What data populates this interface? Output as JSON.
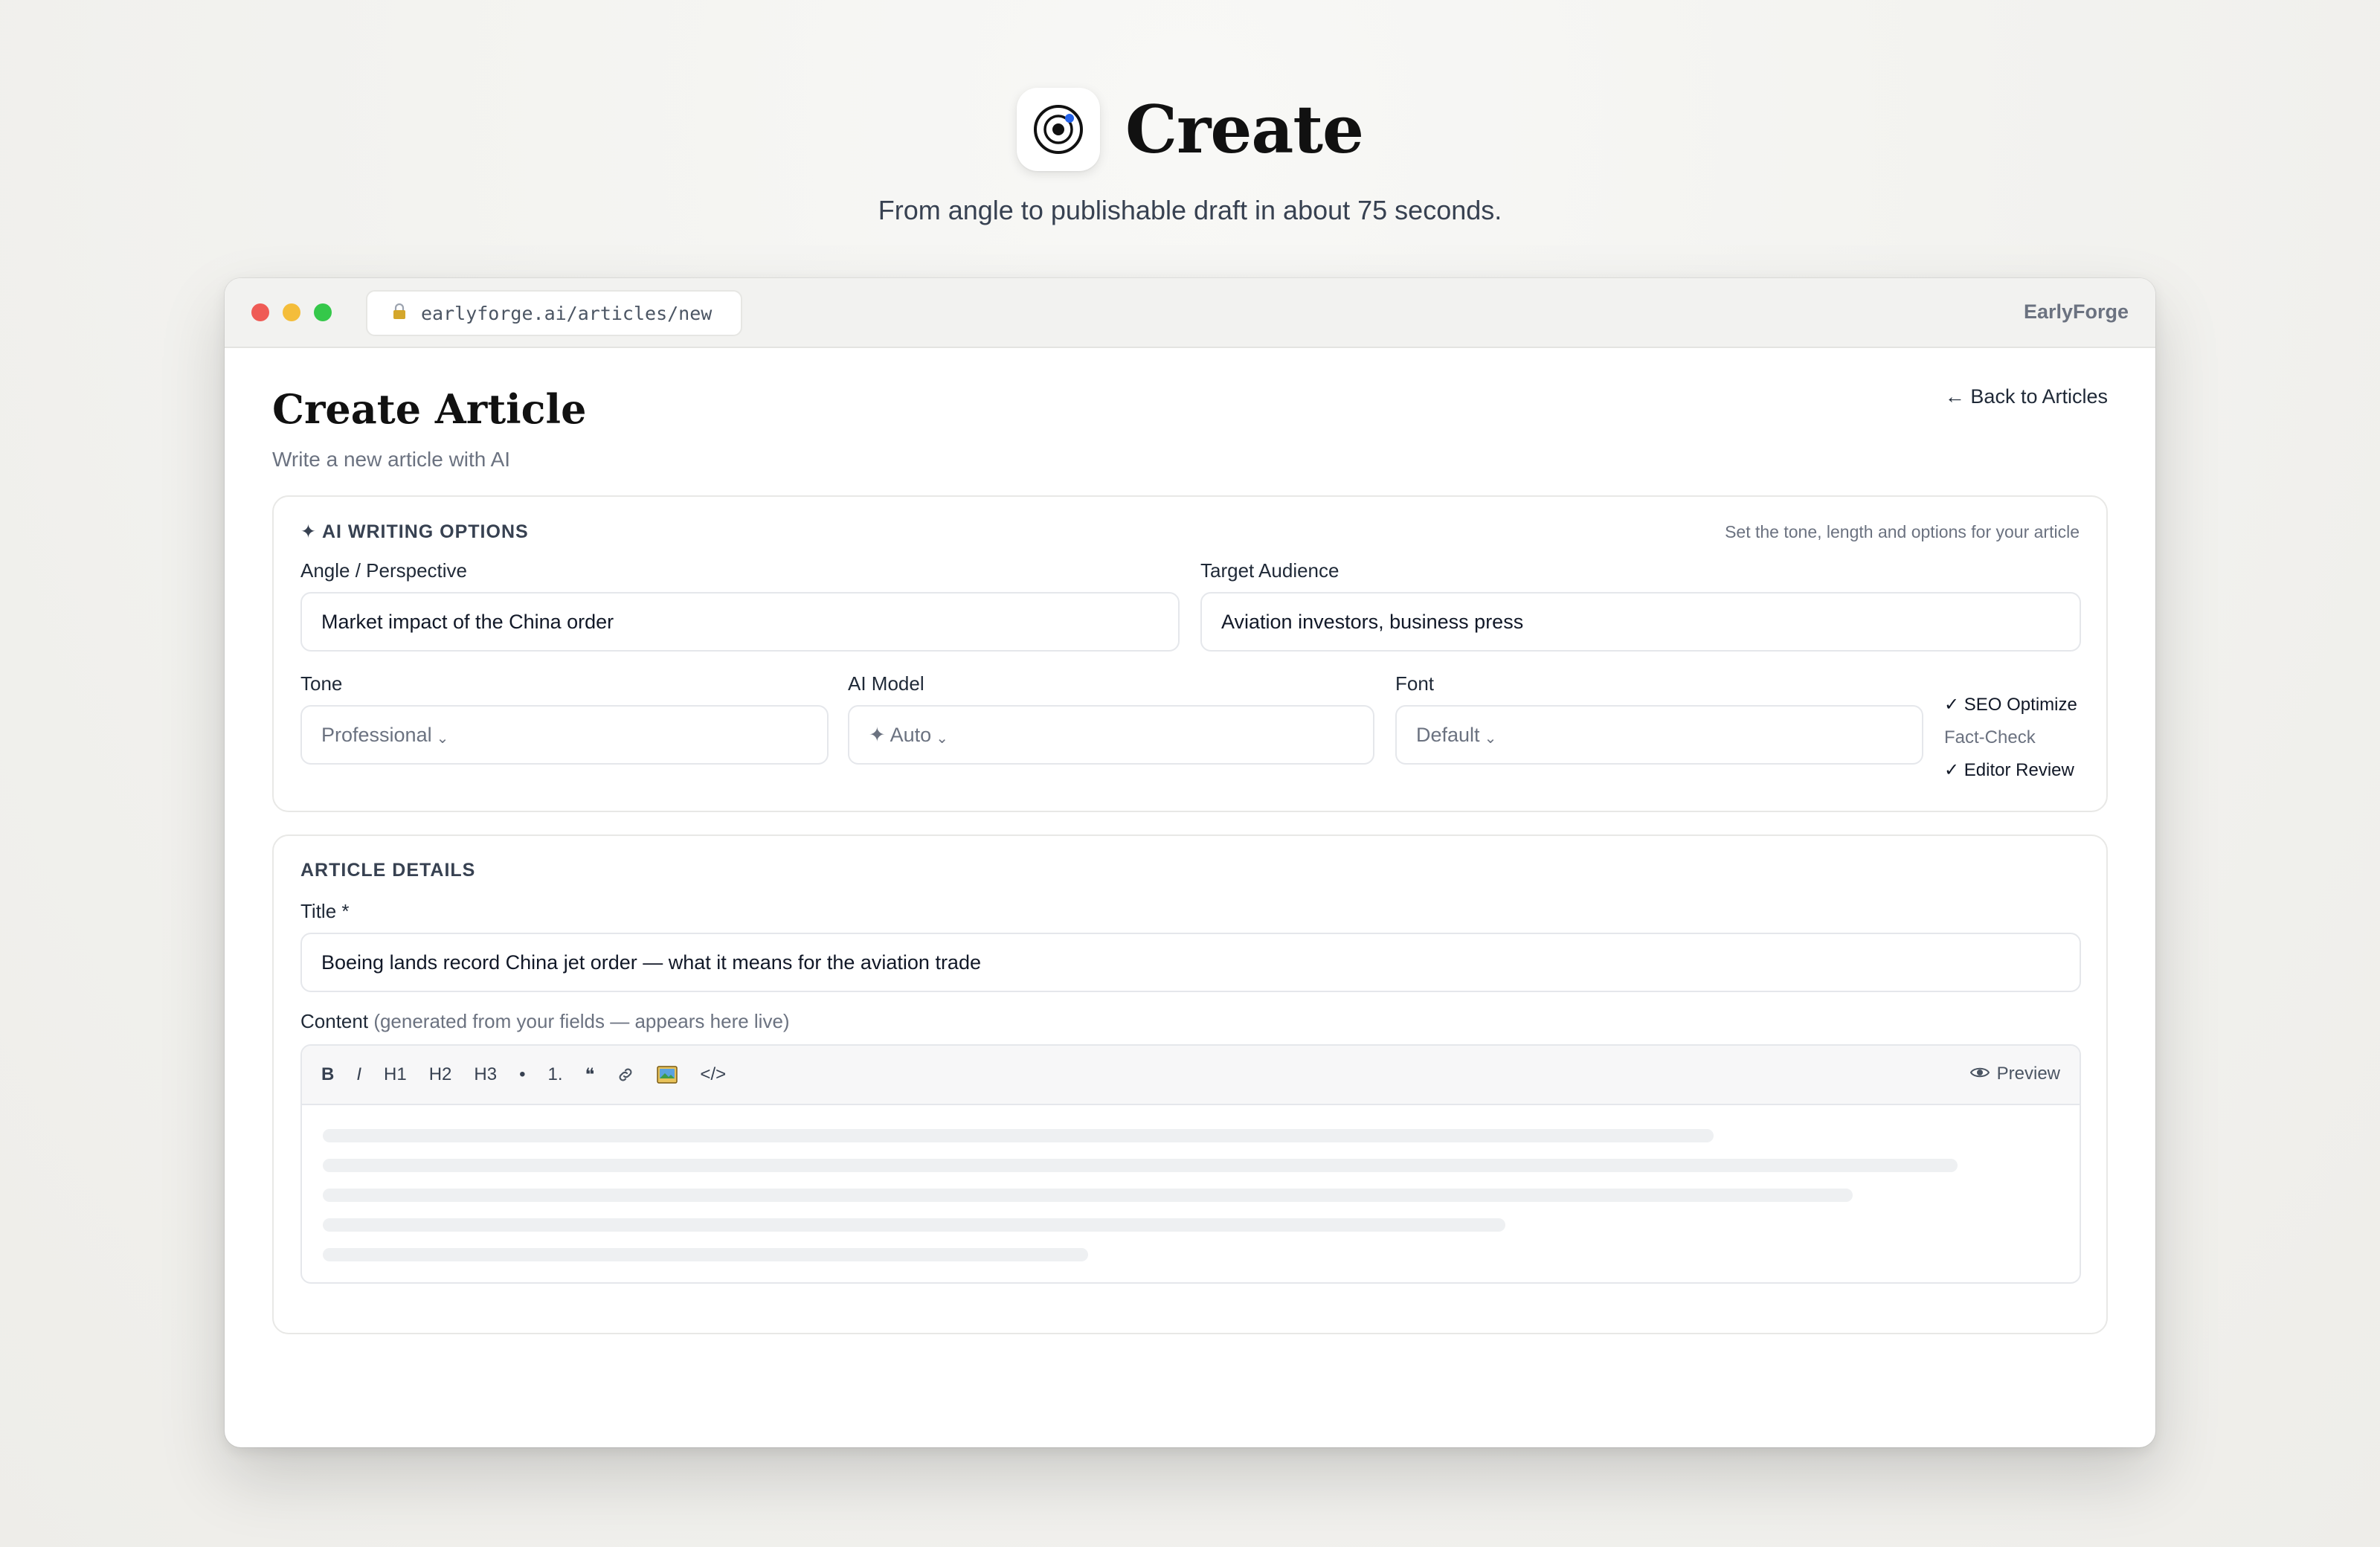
{
  "hero": {
    "title": "Create",
    "subtitle": "From angle to publishable draft in about 75 seconds."
  },
  "browser": {
    "url": "earlyforge.ai/articles/new",
    "brand": "EarlyForge"
  },
  "page": {
    "title": "Create Article",
    "subtitle": "Write a new article with AI",
    "back_link": "← Back to Articles"
  },
  "ai_options": {
    "heading": "✦ AI WRITING OPTIONS",
    "hint": "Set the tone, length and options for your article",
    "angle": {
      "label": "Angle / Perspective",
      "value": "Market impact of the China order"
    },
    "audience": {
      "label": "Target Audience",
      "value": "Aviation investors, business press"
    },
    "tone": {
      "label": "Tone",
      "value": "Professional"
    },
    "model": {
      "label": "AI Model",
      "value": "✦ Auto"
    },
    "font": {
      "label": "Font",
      "value": "Default"
    },
    "checks": {
      "seo": "✓ SEO Optimize",
      "fact": "Fact-Check",
      "editor": "✓ Editor Review"
    }
  },
  "details": {
    "heading": "ARTICLE DETAILS",
    "title_label": "Title *",
    "title_value": "Boeing lands record China jet order — what it means for the aviation trade",
    "content_label": "Content",
    "content_hint": "(generated from your fields — appears here live)",
    "toolbar": [
      "B",
      "I",
      "H1",
      "H2",
      "H3",
      "•",
      "1.",
      "❝",
      "🔗",
      "🖼",
      "</>"
    ],
    "preview": "Preview"
  },
  "skeleton_progress": [
    0.8,
    0.94,
    0.88,
    0.68,
    0.44
  ]
}
